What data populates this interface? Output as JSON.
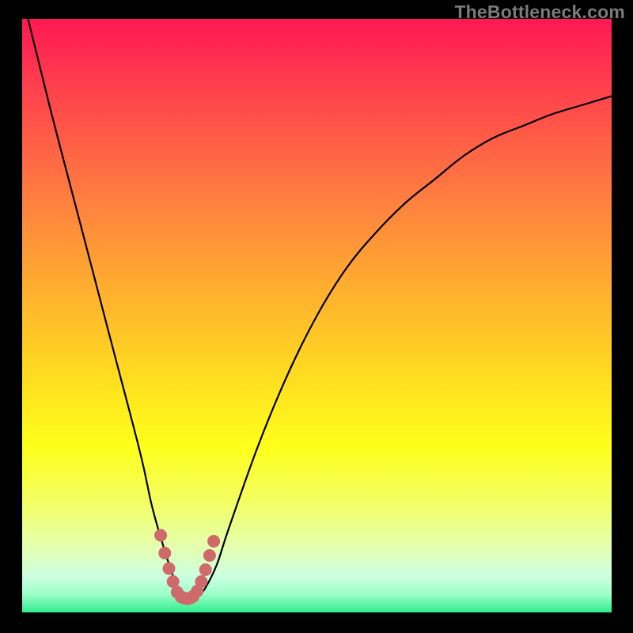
{
  "watermark": "TheBottleneck.com",
  "chart_data": {
    "type": "line",
    "title": "",
    "xlabel": "",
    "ylabel": "",
    "xlim": [
      0,
      100
    ],
    "ylim": [
      0,
      100
    ],
    "series": [
      {
        "name": "bottleneck-curve",
        "x": [
          1,
          5,
          10,
          15,
          20,
          22,
          24,
          26,
          27,
          28,
          29,
          30,
          31,
          33,
          35,
          40,
          45,
          50,
          55,
          60,
          65,
          70,
          75,
          80,
          85,
          90,
          95,
          100
        ],
        "y": [
          100,
          84,
          65,
          46,
          27,
          18,
          11,
          5,
          3,
          2,
          2,
          3,
          4,
          8,
          14,
          28,
          40,
          50,
          58,
          64,
          69,
          73,
          77,
          80,
          82,
          84,
          85.5,
          87
        ]
      },
      {
        "name": "highlight-dots",
        "x": [
          23.5,
          24.2,
          24.9,
          25.6,
          26.3,
          27.0,
          27.0,
          27.5,
          28.0,
          28.5,
          29.0,
          29.0,
          29.7,
          30.4,
          31.1,
          31.8,
          32.5
        ],
        "y": [
          13.0,
          10.0,
          7.4,
          5.2,
          3.4,
          2.6,
          2.6,
          2.4,
          2.3,
          2.4,
          2.7,
          2.7,
          3.6,
          5.2,
          7.2,
          9.6,
          12.0
        ]
      }
    ],
    "colors": {
      "curve": "#000000",
      "dots": "#cf6a6a"
    }
  }
}
